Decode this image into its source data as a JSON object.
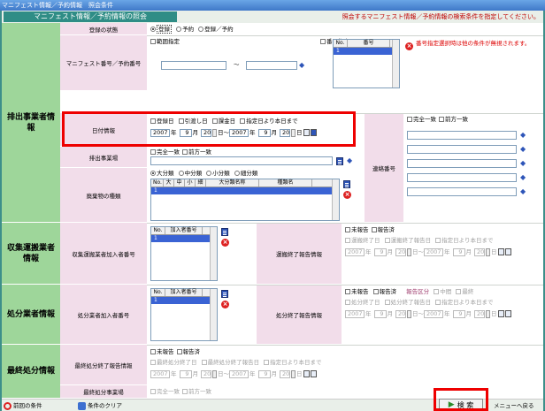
{
  "window": {
    "title": "マニフェスト情報／予約情報　照会条件"
  },
  "header": {
    "tab_label": "マニフェスト情報／予約情報の照会",
    "message": "照会するマニフェスト情報／予約情報の検索条件を指定してください。"
  },
  "sections": {
    "haishutsu": "排出事業者情報",
    "shushu": "収集運搬業者情報",
    "shobun": "処分業者情報",
    "saishu": "最終処分情報"
  },
  "labels": {
    "touroku_jotai": "登録の状態",
    "manifest_no": "マニフェスト番号／予約番号",
    "hizuke": "日付情報",
    "haishutsu_jigyojo": "排出事業場",
    "haikibutsu": "廃棄物の種類",
    "renraku": "連絡番号",
    "shushu_kanyusha": "収集運搬業者加入者番号",
    "unpan_shuryo": "運搬終了報告情報",
    "shobun_kanyusha": "処分業者加入者番号",
    "shobun_shuryo": "処分終了報告情報",
    "saishu_shuryo": "最終処分終了報告情報",
    "saishu_jigyojo": "最終処分事業場"
  },
  "status": {
    "options": [
      "登録",
      "予約",
      "登録／予約"
    ],
    "selected": "登録"
  },
  "manifest": {
    "range_label": "範囲指定",
    "tilde": "～",
    "bango_shitei": "番号指定",
    "list_headers": [
      "No.",
      "番号"
    ],
    "list_first": "1",
    "warning": "番号指定選択時は他の条件が無視されます。"
  },
  "date_info": {
    "checks": [
      "登録日",
      "引渡し日",
      "課金日",
      "指定日より本日まで"
    ],
    "from": {
      "year": "2007",
      "month": "9",
      "day": "20"
    },
    "to": {
      "year": "2007",
      "month": "9",
      "day": "20"
    },
    "nen": "年",
    "tsuki": "月",
    "hi": "日",
    "tilde": "～"
  },
  "match": {
    "exact": "完全一致",
    "prefix": "前方一致"
  },
  "waste": {
    "radios": [
      "大分類",
      "中分類",
      "小分類",
      "細分類"
    ],
    "selected": "大分類",
    "headers": [
      "No.",
      "大",
      "中",
      "小",
      "細",
      "大分類名称",
      "種類名"
    ],
    "first": "1"
  },
  "kanyusha": {
    "headers": [
      "No.",
      "加入者番号"
    ],
    "first": "1"
  },
  "report": {
    "unreported": "未報告",
    "reported": "報告済",
    "unpan_checks": [
      "運搬終了日",
      "運搬終了報告日",
      "指定日より本日まで"
    ],
    "shobun_checks": [
      "処分終了日",
      "処分終了報告日",
      "指定日より本日まで"
    ],
    "saishu_checks": [
      "最終処分終了日",
      "最終処分終了報告日",
      "指定日より本日まで"
    ],
    "kubun_label": "報告区分",
    "kubun_options": [
      "中間",
      "最終"
    ],
    "year": "2007",
    "month": "9",
    "day": "20"
  },
  "bottom": {
    "prev": "前回の条件",
    "clear": "条件のクリア",
    "search": "検 索",
    "menu": "メニューへ戻る"
  },
  "colors": {
    "section_green": "#9ed69a",
    "label_pink": "#f2ddea",
    "highlight": "#ee0000",
    "title_teal": "#2f8d86"
  }
}
